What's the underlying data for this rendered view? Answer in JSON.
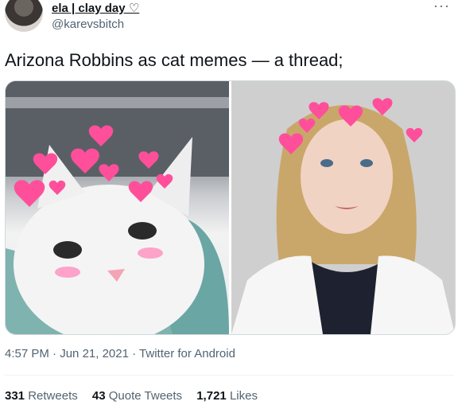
{
  "user": {
    "display_name": "ela | clay day ♡",
    "handle": "@karevsbitch"
  },
  "more_glyph": "···",
  "tweet": {
    "text": "Arizona Robbins as cat memes — a thread;"
  },
  "media": {
    "items": [
      {
        "icon": "cat-photo"
      },
      {
        "icon": "woman-photo"
      }
    ]
  },
  "meta": {
    "time": "4:57 PM",
    "sep1": " · ",
    "date": "Jun 21, 2021",
    "sep2": " · ",
    "source": "Twitter for Android"
  },
  "stats": {
    "retweets_count": "331",
    "retweets_label": "Retweets",
    "quotes_count": "43",
    "quotes_label": "Quote Tweets",
    "likes_count": "1,721",
    "likes_label": "Likes"
  },
  "colors": {
    "text": "#0f1419",
    "secondary": "#536471",
    "hearts": "#ff4f9a"
  }
}
